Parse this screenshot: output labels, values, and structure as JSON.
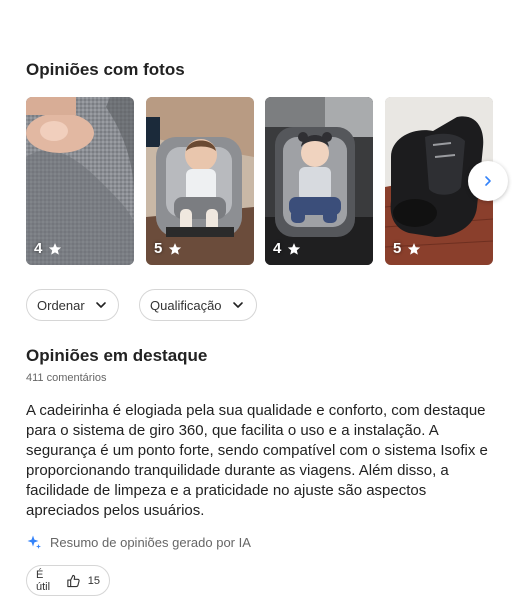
{
  "photos": {
    "title": "Opiniões com fotos",
    "items": [
      {
        "rating": "4",
        "subject": "close-up-hand-on-seat"
      },
      {
        "rating": "5",
        "subject": "baby-in-grey-car-seat"
      },
      {
        "rating": "4",
        "subject": "baby-in-car-seat-in-car"
      },
      {
        "rating": "5",
        "subject": "black-car-seat-in-car"
      }
    ]
  },
  "filters": {
    "sort_label": "Ordenar",
    "rating_label": "Qualificação"
  },
  "featured": {
    "title": "Opiniões em destaque",
    "count": "411 comentários",
    "summary": "A cadeirinha é elogiada pela sua qualidade e conforto, com destaque para o sistema de giro 360, que facilita o uso e a instalação. A segurança é um ponto forte, sendo compatível com o sistema Isofix e proporcionando tranquilidade durante as viagens. Além disso, a facilidade de limpeza e a praticidade no ajuste são aspectos apreciados pelos usuários.",
    "ai_note": "Resumo de opiniões gerado por IA",
    "helpful_label": "É útil",
    "helpful_count": "15"
  },
  "colors": {
    "accent": "#3483fa",
    "text": "#1f1f1f",
    "muted": "#666666"
  }
}
